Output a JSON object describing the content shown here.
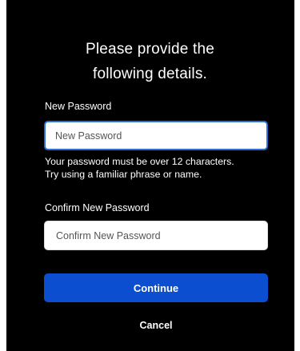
{
  "form": {
    "heading_line1": "Please provide the",
    "heading_line2": "following details.",
    "new_password": {
      "label": "New Password",
      "placeholder": "New Password",
      "value": ""
    },
    "hint_line1": "Your password must be over 12 characters.",
    "hint_line2": "Try using a familiar phrase or name.",
    "confirm_password": {
      "label": "Confirm New Password",
      "placeholder": "Confirm New Password",
      "value": ""
    },
    "continue_label": "Continue",
    "cancel_label": "Cancel"
  },
  "colors": {
    "background": "#000000",
    "primary_button": "#0b4fd0",
    "focus_border": "#2a6fd6",
    "text": "#ffffff"
  }
}
